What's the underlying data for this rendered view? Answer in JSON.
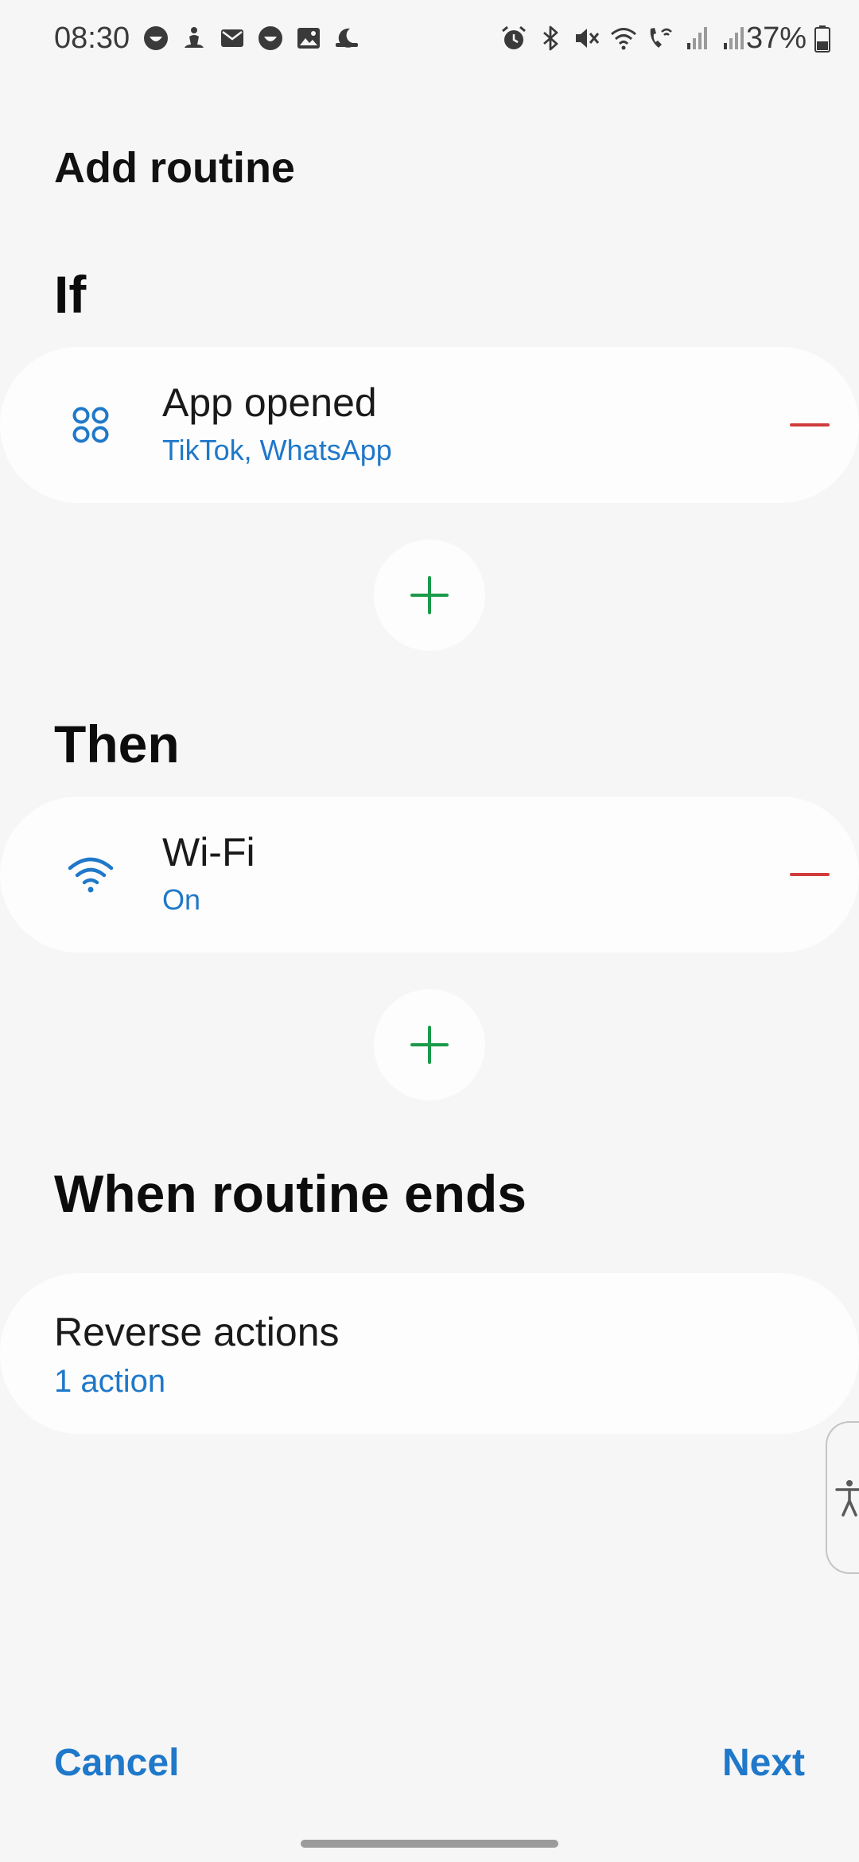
{
  "status_bar": {
    "time": "08:30",
    "battery_percent": "37%",
    "left_icons": [
      "face-icon",
      "meditation-icon",
      "mail-icon",
      "face-icon",
      "gallery-icon",
      "sleep-icon"
    ],
    "right_icons": [
      "alarm-icon",
      "bluetooth-icon",
      "mute-icon",
      "wifi-icon",
      "wifi-calling-icon",
      "signal-icon",
      "signal-icon"
    ]
  },
  "page": {
    "title": "Add routine"
  },
  "if_section": {
    "heading": "If",
    "condition": {
      "icon": "apps-grid-icon",
      "title": "App opened",
      "subtitle": "TikTok, WhatsApp"
    }
  },
  "then_section": {
    "heading": "Then",
    "action": {
      "icon": "wifi-icon",
      "title": "Wi-Fi",
      "subtitle": "On"
    }
  },
  "end_section": {
    "heading": "When routine ends",
    "reverse": {
      "title": "Reverse actions",
      "subtitle": "1 action"
    }
  },
  "footer": {
    "cancel_label": "Cancel",
    "next_label": "Next"
  },
  "colors": {
    "accent": "#1f78c9",
    "remove": "#d13c3c",
    "add": "#1a9a4a",
    "background": "#f6f6f6",
    "card": "#fdfdfd"
  }
}
